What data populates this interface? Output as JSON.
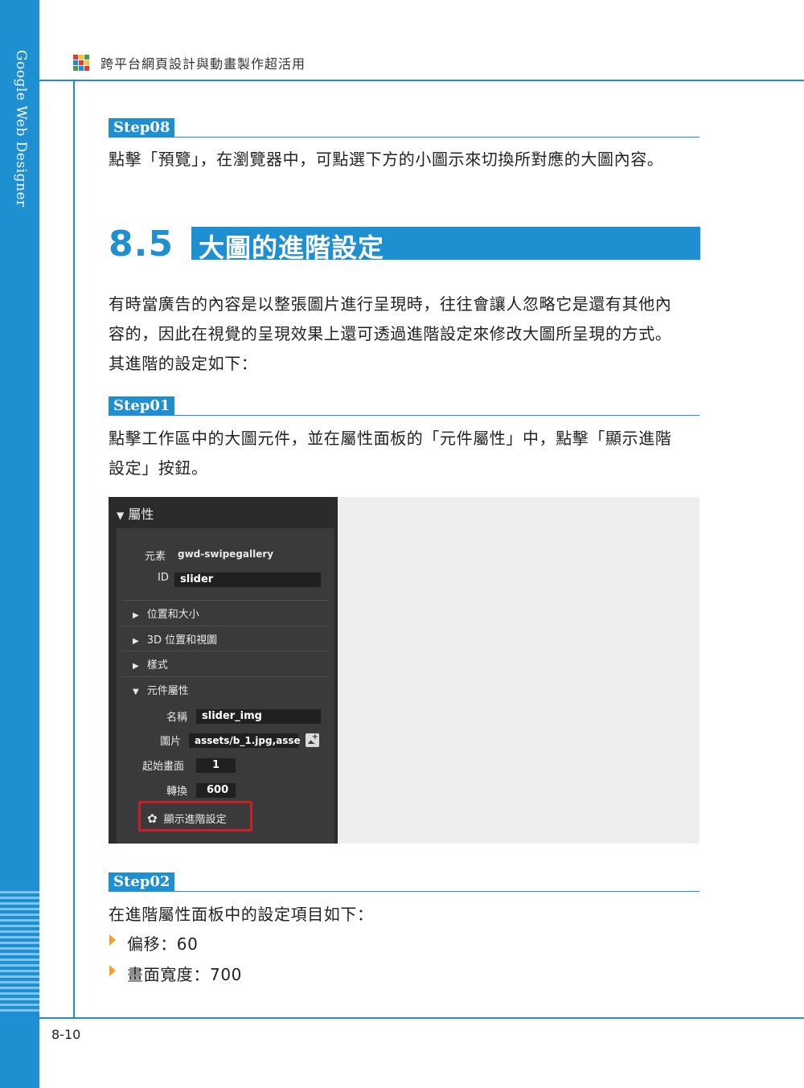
{
  "sidebar": {
    "title": "Google Web Designer"
  },
  "header": {
    "book_title": "跨平台網頁設計與動畫製作超活用"
  },
  "step08": {
    "label": "Step08",
    "text": "點擊「預覽」，在瀏覽器中，可點選下方的小圖示來切換所對應的大圖內容。"
  },
  "section": {
    "number": "8.5",
    "title": "大圖的進階設定"
  },
  "intro": {
    "lines": [
      "有時當廣告的內容是以整張圖片進行呈現時，往往會讓人忽略它是還有其他內",
      "容的，因此在視覺的呈現效果上還可透過進階設定來修改大圖所呈現的方式。",
      "其進階的設定如下："
    ]
  },
  "step01": {
    "label": "Step01",
    "lines": [
      "點擊工作區中的大圖元件，並在屬性面板的「元件屬性」中，點擊「顯示進階",
      "設定」按鈕。"
    ]
  },
  "panel": {
    "header": "屬性",
    "element_label": "元素",
    "element_value": "gwd-swipegallery",
    "id_label": "ID",
    "id_value": "slider",
    "sections": [
      "位置和大小",
      "3D 位置和視圖",
      "樣式",
      "元件屬性"
    ],
    "name_label": "名稱",
    "name_value": "slider_img",
    "image_label": "圖片",
    "image_value": "assets/b_1.jpg,asse",
    "start_label": "起始畫面",
    "start_value": "1",
    "transition_label": "轉換",
    "transition_value": "600",
    "advanced_button": "顯示進階設定"
  },
  "step02": {
    "label": "Step02",
    "text": "在進階屬性面板中的設定項目如下：",
    "bullets": [
      "偏移：60",
      "畫面寬度：700"
    ]
  },
  "footer": {
    "page_number": "8-10"
  },
  "colors": {
    "accent": "#1e8fd1",
    "highlight": "#c62128",
    "bullet": "#f0a030"
  }
}
